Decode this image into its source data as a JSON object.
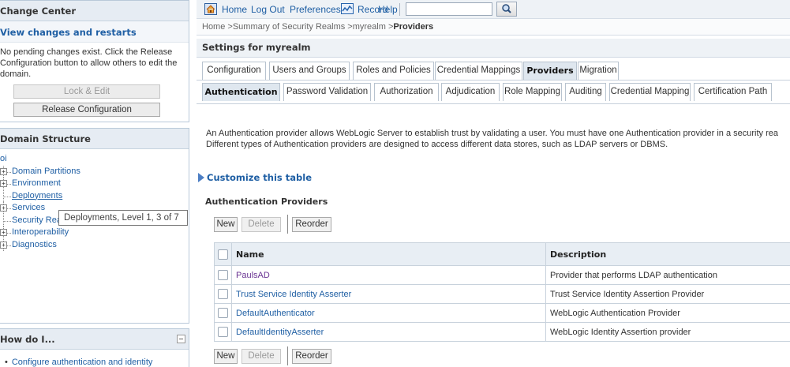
{
  "change_center": {
    "title": "Change Center",
    "link": "View changes and restarts",
    "message": "No pending changes exist. Click the Release Configuration button to allow others to edit the domain.",
    "lock_edit_label": "Lock & Edit",
    "release_label": "Release Configuration"
  },
  "domain_structure": {
    "title": "Domain Structure",
    "root": "oi",
    "items": [
      {
        "label": "Domain Partitions",
        "expandable": true
      },
      {
        "label": "Environment",
        "expandable": true
      },
      {
        "label": "Deployments",
        "expandable": false
      },
      {
        "label": "Services",
        "expandable": true
      },
      {
        "label": "Security Rea",
        "expandable": false
      },
      {
        "label": "Interoperability",
        "expandable": true
      },
      {
        "label": "Diagnostics",
        "expandable": true
      }
    ],
    "tooltip": "Deployments, Level 1, 3 of 7"
  },
  "how_do_i": {
    "title": "How do I...",
    "items": [
      "Configure authentication and identity"
    ]
  },
  "toolbar": {
    "home": "Home",
    "logout": "Log Out",
    "preferences": "Preferences",
    "record": "Record",
    "help": "Help",
    "search_value": ""
  },
  "breadcrumb": {
    "prefix": "Home >Summary of Security Realms >myrealm >",
    "current": "Providers"
  },
  "settings_title": "Settings for myrealm",
  "tabs_primary": [
    "Configuration",
    "Users and Groups",
    "Roles and Policies",
    "Credential Mappings",
    "Providers",
    "Migration"
  ],
  "tabs_primary_active": "Providers",
  "tabs_secondary": [
    "Authentication",
    "Password Validation",
    "Authorization",
    "Adjudication",
    "Role Mapping",
    "Auditing",
    "Credential Mapping",
    "Certification Path"
  ],
  "tabs_secondary_active": "Authentication",
  "description": {
    "line1": "An Authentication provider allows WebLogic Server to establish trust by validating a user. You must have one Authentication provider in a security rea",
    "line2": "Different types of Authentication providers are designed to access different data stores, such as LDAP servers or DBMS."
  },
  "customize_label": "Customize this table",
  "table": {
    "title": "Authentication Providers",
    "new_label": "New",
    "delete_label": "Delete",
    "reorder_label": "Reorder",
    "columns": [
      "Name",
      "Description"
    ],
    "rows": [
      {
        "name": "PaulsAD",
        "description": "Provider that performs LDAP authentication"
      },
      {
        "name": "Trust Service Identity Asserter",
        "description": "Trust Service Identity Assertion Provider"
      },
      {
        "name": "DefaultAuthenticator",
        "description": "WebLogic Authentication Provider"
      },
      {
        "name": "DefaultIdentityAsserter",
        "description": "WebLogic Identity Assertion provider"
      }
    ]
  }
}
